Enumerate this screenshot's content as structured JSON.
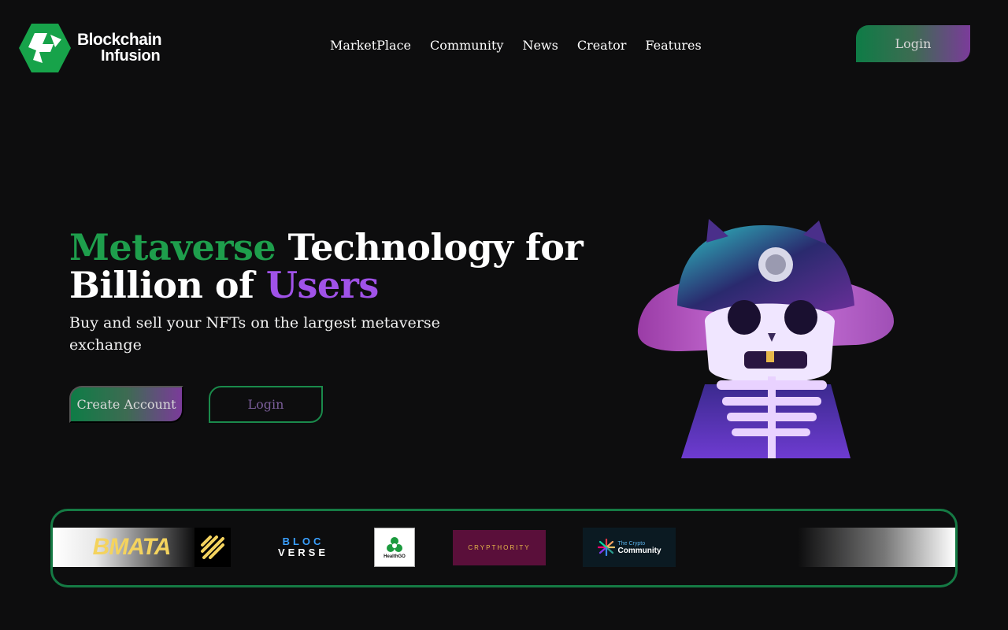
{
  "brand": {
    "logo_line1": "Blockchain",
    "logo_line2": "Infusion",
    "colors": {
      "green": "#1e9e4c",
      "purple": "#a052e8",
      "background": "#0d0d0e",
      "border": "#157a44"
    }
  },
  "nav": {
    "items": [
      "MarketPlace",
      "Community",
      "News",
      "Creator",
      "Features"
    ]
  },
  "header": {
    "login_label": "Login"
  },
  "hero": {
    "title_part1": "Metaverse",
    "title_part2": " Technology for",
    "title_part3": "Billion of ",
    "title_part4": "Users",
    "subtitle": "Buy and sell your NFTs on the largest metaverse exchange",
    "create_account_label": "Create Account",
    "login_label": "Login",
    "illustration": "skeleton-cat-hat-icon"
  },
  "partners": {
    "bmata": "BMATA",
    "blocverse_r1": "BLOC",
    "blocverse_r2": "VERSE",
    "healthgo": "HealthGO",
    "crypthority": "CRYPTHORITY",
    "cryptocomm_t1": "The Crypto",
    "cryptocomm_t2": "Community"
  }
}
